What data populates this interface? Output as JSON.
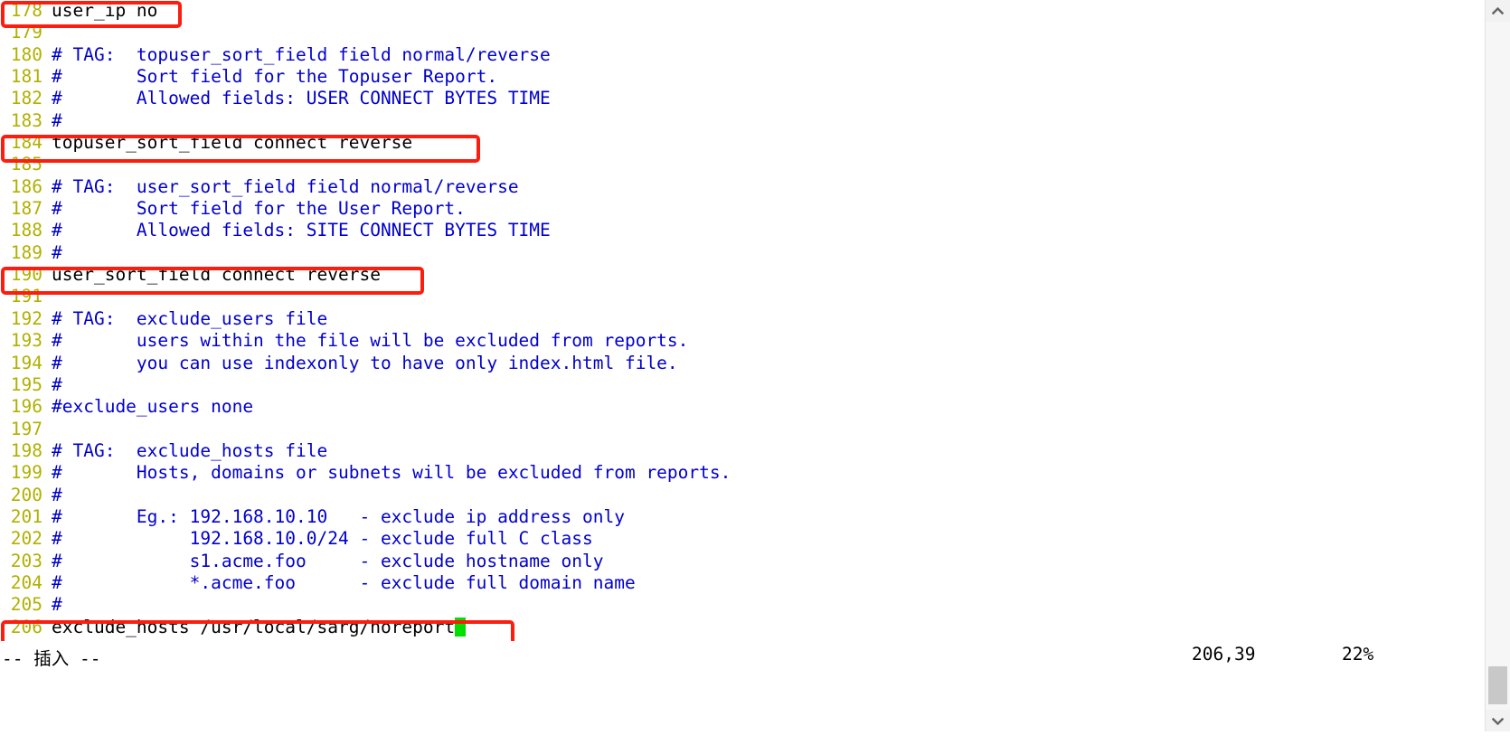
{
  "editor": {
    "app": "vim",
    "cursor_color": "#00e000",
    "line_number_color": "#b0b000",
    "comment_color": "#0000cd",
    "code_color": "#000000",
    "annotation_color": "#fb1d0f",
    "lines": [
      {
        "num": "178",
        "text": "user_ip no",
        "kind": "code"
      },
      {
        "num": "179",
        "text": "",
        "kind": "code"
      },
      {
        "num": "180",
        "text": "# TAG:  topuser_sort_field field normal/reverse",
        "kind": "comment"
      },
      {
        "num": "181",
        "text": "#       Sort field for the Topuser Report.",
        "kind": "comment"
      },
      {
        "num": "182",
        "text": "#       Allowed fields: USER CONNECT BYTES TIME",
        "kind": "comment"
      },
      {
        "num": "183",
        "text": "#",
        "kind": "comment"
      },
      {
        "num": "184",
        "text": "topuser_sort_field connect reverse",
        "kind": "code"
      },
      {
        "num": "185",
        "text": "",
        "kind": "code"
      },
      {
        "num": "186",
        "text": "# TAG:  user_sort_field field normal/reverse",
        "kind": "comment"
      },
      {
        "num": "187",
        "text": "#       Sort field for the User Report.",
        "kind": "comment"
      },
      {
        "num": "188",
        "text": "#       Allowed fields: SITE CONNECT BYTES TIME",
        "kind": "comment"
      },
      {
        "num": "189",
        "text": "#",
        "kind": "comment"
      },
      {
        "num": "190",
        "text": "user_sort_field connect reverse",
        "kind": "code"
      },
      {
        "num": "191",
        "text": "",
        "kind": "code"
      },
      {
        "num": "192",
        "text": "# TAG:  exclude_users file",
        "kind": "comment"
      },
      {
        "num": "193",
        "text": "#       users within the file will be excluded from reports.",
        "kind": "comment"
      },
      {
        "num": "194",
        "text": "#       you can use indexonly to have only index.html file.",
        "kind": "comment"
      },
      {
        "num": "195",
        "text": "#",
        "kind": "comment"
      },
      {
        "num": "196",
        "text": "#exclude_users none",
        "kind": "comment"
      },
      {
        "num": "197",
        "text": "",
        "kind": "code"
      },
      {
        "num": "198",
        "text": "# TAG:  exclude_hosts file",
        "kind": "comment"
      },
      {
        "num": "199",
        "text": "#       Hosts, domains or subnets will be excluded from reports.",
        "kind": "comment"
      },
      {
        "num": "200",
        "text": "#",
        "kind": "comment"
      },
      {
        "num": "201",
        "text": "#       Eg.: 192.168.10.10   - exclude ip address only",
        "kind": "comment"
      },
      {
        "num": "202",
        "text": "#            192.168.10.0/24 - exclude full C class",
        "kind": "comment"
      },
      {
        "num": "203",
        "text": "#            s1.acme.foo     - exclude hostname only",
        "kind": "comment"
      },
      {
        "num": "204",
        "text": "#            *.acme.foo      - exclude full domain name",
        "kind": "comment"
      },
      {
        "num": "205",
        "text": "#",
        "kind": "comment"
      },
      {
        "num": "206",
        "text": "exclude_hosts /usr/local/sarg/noreport",
        "kind": "code"
      }
    ]
  },
  "status": {
    "mode": "-- 插入 --",
    "position": "206,39",
    "percent": "22%"
  },
  "annotations": [
    {
      "label": "highlight-user-ip-line",
      "line": "178"
    },
    {
      "label": "highlight-topuser-sort-field-line",
      "line": "184"
    },
    {
      "label": "highlight-user-sort-field-line",
      "line": "190"
    },
    {
      "label": "highlight-exclude-hosts-line",
      "line": "206"
    }
  ],
  "scrollbar": {
    "up_arrow": "chevron-up-icon",
    "down_arrow": "chevron-down-icon"
  }
}
